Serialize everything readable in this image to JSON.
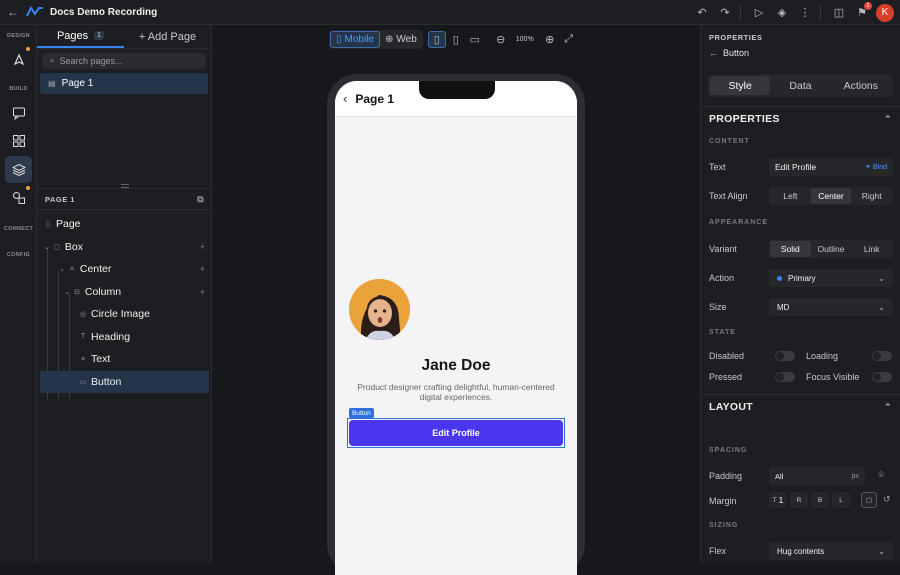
{
  "header": {
    "title": "Docs Demo Recording",
    "notification_count": "1",
    "user_initial": "K"
  },
  "rail": {
    "design_label": "DESIGN",
    "build_label": "BUILD",
    "connect_label": "CONNECT",
    "config_label": "CONFIG"
  },
  "left_panel": {
    "tabs": {
      "pages": "Pages",
      "pages_count": "1",
      "add_page": "+ Add Page"
    },
    "search_placeholder": "Search pages...",
    "pages": [
      "Page 1"
    ],
    "section_title": "PAGE 1",
    "tree": [
      {
        "label": "Page",
        "icon": "page-icon"
      },
      {
        "label": "Box",
        "icon": "box-icon"
      },
      {
        "label": "Center",
        "icon": "center-icon"
      },
      {
        "label": "Column",
        "icon": "column-icon"
      },
      {
        "label": "Circle Image",
        "icon": "image-icon"
      },
      {
        "label": "Heading",
        "icon": "heading-icon"
      },
      {
        "label": "Text",
        "icon": "text-icon"
      },
      {
        "label": "Button",
        "icon": "button-icon"
      }
    ]
  },
  "canvas": {
    "device_tabs": {
      "mobile": "Mobile",
      "web": "Web"
    },
    "zoom": "100%",
    "phone": {
      "page_title": "Page 1",
      "name": "Jane Doe",
      "bio": "Product designer crafting delightful, human-centered digital experiences.",
      "selection_tag": "Button",
      "button_label": "Edit Profile",
      "button_color": "#4a36ee"
    }
  },
  "right_panel": {
    "kicker": "PROPERTIES",
    "component": "Button",
    "tabs": {
      "style": "Style",
      "data": "Data",
      "actions": "Actions"
    },
    "properties_title": "PROPERTIES",
    "content_label": "CONTENT",
    "text_label": "Text",
    "text_value": "Edit Profile",
    "bind_label": "Bind",
    "align_label": "Text Align",
    "align_options": [
      "Left",
      "Center",
      "Right"
    ],
    "appearance_label": "APPEARANCE",
    "variant_label": "Variant",
    "variant_options": [
      "Solid",
      "Outline",
      "Link"
    ],
    "action_label": "Action",
    "action_value": "Primary",
    "size_label": "Size",
    "size_value": "MD",
    "state_label": "STATE",
    "disabled_label": "Disabled",
    "loading_label": "Loading",
    "pressed_label": "Pressed",
    "focus_label": "Focus Visible",
    "layout_title": "LAYOUT",
    "spacing_label": "SPACING",
    "padding_label": "Padding",
    "padding_value": "All",
    "padding_unit": "px",
    "margin_label": "Margin",
    "margin_sides": [
      "T",
      "R",
      "B",
      "L"
    ],
    "margin_top_value": "1",
    "sizing_label": "SIZING",
    "flex_label": "Flex",
    "flex_value": "Hug contents"
  }
}
